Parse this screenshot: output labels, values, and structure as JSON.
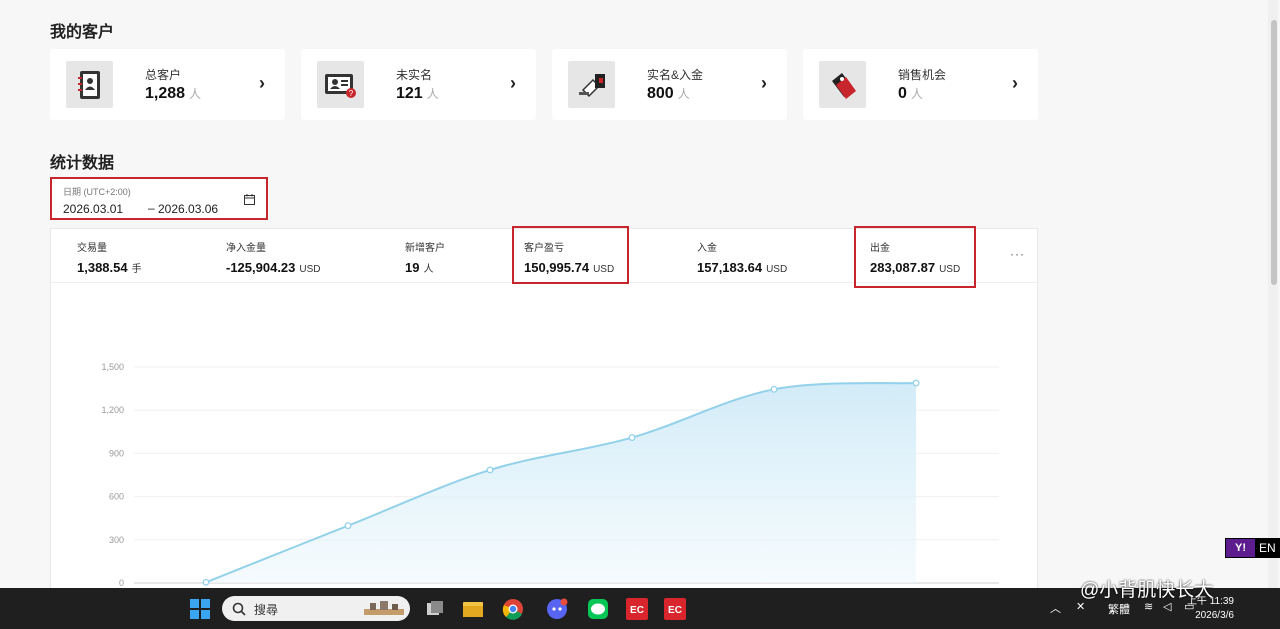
{
  "customers": {
    "title": "我的客户",
    "cards": [
      {
        "label": "总客户",
        "value": "1,288",
        "unit": "人",
        "icon": "address-book-icon"
      },
      {
        "label": "未实名",
        "value": "121",
        "unit": "人",
        "icon": "id-card-warning-icon"
      },
      {
        "label": "实名&入金",
        "value": "800",
        "unit": "人",
        "icon": "wallet-icon"
      },
      {
        "label": "销售机会",
        "value": "0",
        "unit": "人",
        "icon": "price-tag-icon"
      }
    ]
  },
  "stats": {
    "title": "统计数据",
    "date": {
      "label": "日期 (UTC+2:00)",
      "from": "2026.03.01",
      "separator": "–",
      "to": "2026.03.06"
    },
    "metrics": [
      {
        "label": "交易量",
        "value": "1,388.54",
        "unit": "手"
      },
      {
        "label": "净入金量",
        "value": "-125,904.23",
        "unit": "USD"
      },
      {
        "label": "新增客户",
        "value": "19",
        "unit": "人"
      },
      {
        "label": "客户盈亏",
        "value": "150,995.74",
        "unit": "USD"
      },
      {
        "label": "入金",
        "value": "157,183.64",
        "unit": "USD"
      },
      {
        "label": "出金",
        "value": "283,087.87",
        "unit": "USD"
      }
    ],
    "more_label": "···"
  },
  "chart_data": {
    "type": "area",
    "title": "",
    "xlabel": "",
    "ylabel": "",
    "ylim": [
      0,
      1500
    ],
    "yticks": [
      0,
      300,
      600,
      900,
      1200,
      1500
    ],
    "ytick_labels": [
      "0",
      "300",
      "600",
      "900",
      "1,200",
      "1,500"
    ],
    "x": [
      1,
      2,
      3,
      4,
      5,
      6
    ],
    "series": [
      {
        "values": [
          5,
          398,
          785,
          1010,
          1345,
          1388.54
        ]
      }
    ],
    "grid": true,
    "colors": {
      "line": "#93d1ea",
      "fill": "#d3ecf8"
    }
  },
  "taskbar": {
    "search_placeholder": "搜尋",
    "tray_ime": "繁體",
    "time": "上午 11:39",
    "date": "2026/3/6"
  },
  "lang": {
    "logo": "Y!",
    "text": "EN"
  },
  "watermark": "@小背肌快长大",
  "colors": {
    "highlight": "#c8262c",
    "page_bg": "#f7f7f7"
  }
}
